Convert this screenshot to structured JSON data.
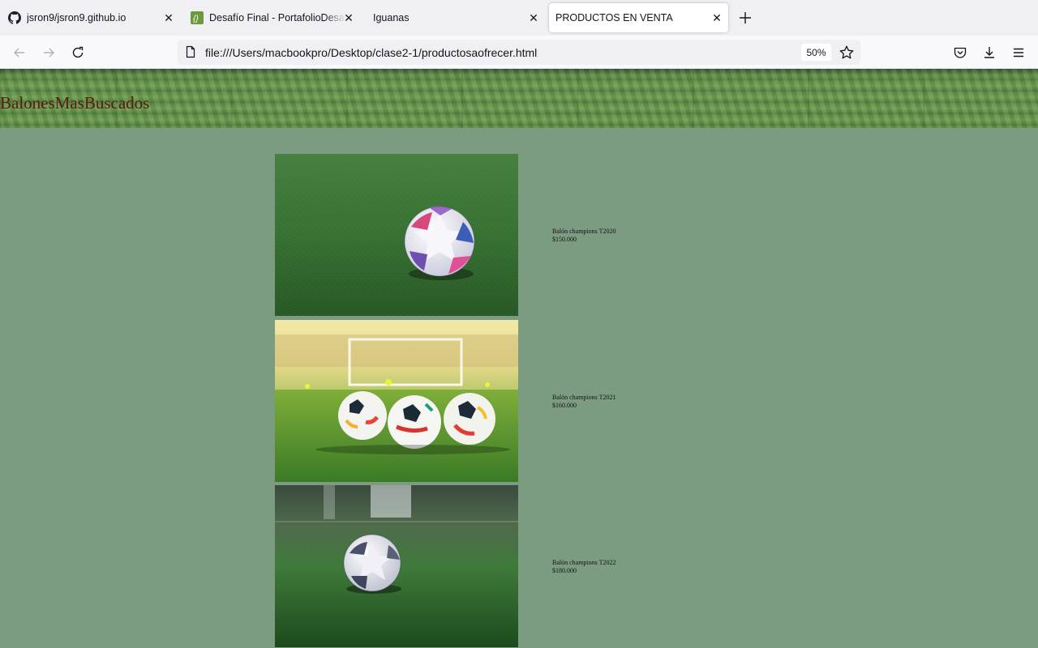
{
  "browser": {
    "tabs": [
      {
        "title": "jsron9/jsron9.github.io",
        "favicon": "github-icon",
        "active": false
      },
      {
        "title": "Desafío Final - PortafolioDesafío",
        "favicon": "site-icon",
        "active": false
      },
      {
        "title": "Iguanas",
        "favicon": "",
        "active": false
      },
      {
        "title": "PRODUCTOS EN VENTA",
        "favicon": "",
        "active": true
      }
    ],
    "url": "file:///Users/macbookpro/Desktop/clase2-1/productosaofrecer.html",
    "zoom": "50%"
  },
  "page": {
    "brand": "BalonesMasBuscados",
    "products": [
      {
        "name": "Balón champions T2020",
        "price": "$150.000",
        "image": "ball-on-grass-champions"
      },
      {
        "name": "Balón champions T2021",
        "price": "$160.000",
        "image": "three-balls-near-goal"
      },
      {
        "name": "Balón champions T2022",
        "price": "$180.000",
        "image": "ball-on-turf-blurred"
      }
    ]
  },
  "colors": {
    "page_bg": "#7c9c82",
    "brand_text": "#5a1a12",
    "tab_bg": "#f0f0f4",
    "toolbar_bg": "#f9f9fb"
  }
}
